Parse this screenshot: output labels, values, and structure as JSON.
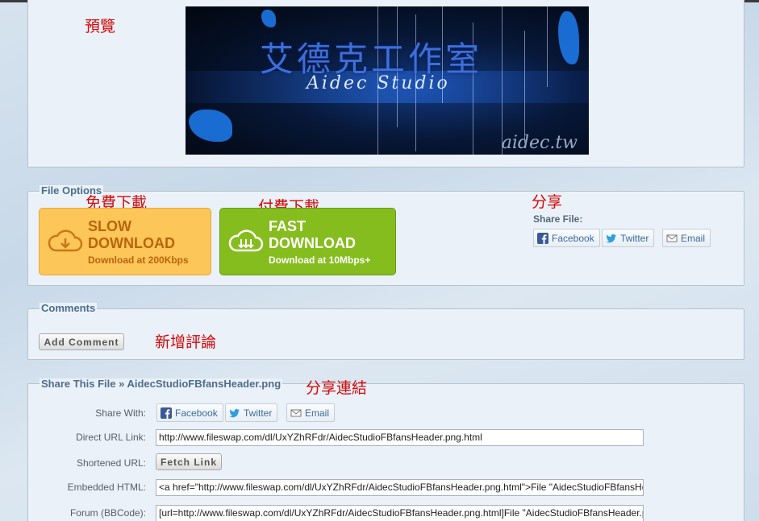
{
  "annotations": {
    "preview": "預覽",
    "free_download": "免費下載",
    "paid_download": "付費下載",
    "share": "分享",
    "add_comment": "新增評論",
    "share_link": "分享連結"
  },
  "preview": {
    "banner_title_cjk": "艾德克工作室",
    "banner_title_latin": "Aidec Studio",
    "banner_corner": "aidec.tw"
  },
  "file_options": {
    "legend": "File Options",
    "slow": {
      "title_line1": "SLOW",
      "title_line2": "DOWNLOAD",
      "subtitle": "Download at 200Kbps"
    },
    "fast": {
      "title_line1": "FAST",
      "title_line2": "DOWNLOAD",
      "subtitle": "Download at 10Mbps+"
    },
    "share_label": "Share File:",
    "share_buttons": [
      "Facebook",
      "Twitter",
      "Email"
    ]
  },
  "comments": {
    "legend": "Comments",
    "add_button": "Add Comment"
  },
  "share_this_file": {
    "legend": "Share This File » AidecStudioFBfansHeader.png",
    "share_with_label": "Share With:",
    "share_buttons": [
      "Facebook",
      "Twitter",
      "Email"
    ],
    "direct_label": "Direct URL Link:",
    "direct_value": "http://www.fileswap.com/dl/UxYZhRFdr/AidecStudioFBfansHeader.png.html",
    "shortened_label": "Shortened URL:",
    "fetch_button": "Fetch Link",
    "embedded_label": "Embedded HTML:",
    "embedded_value": "<a href=\"http://www.fileswap.com/dl/UxYZhRFdr/AidecStudioFBfansHeader.png.html\">File \"AidecStudioFBfansHeader.png\"</a>",
    "forum_label": "Forum (BBCode):",
    "forum_value": "[url=http://www.fileswap.com/dl/UxYZhRFdr/AidecStudioFBfansHeader.png.html]File \"AidecStudioFBfansHeader.png\"[/url]"
  },
  "colors": {
    "annotation": "#d20a0a",
    "slow_button": "#fdc658",
    "fast_button": "#86bd1e",
    "legend_text": "#4c6d8c"
  }
}
